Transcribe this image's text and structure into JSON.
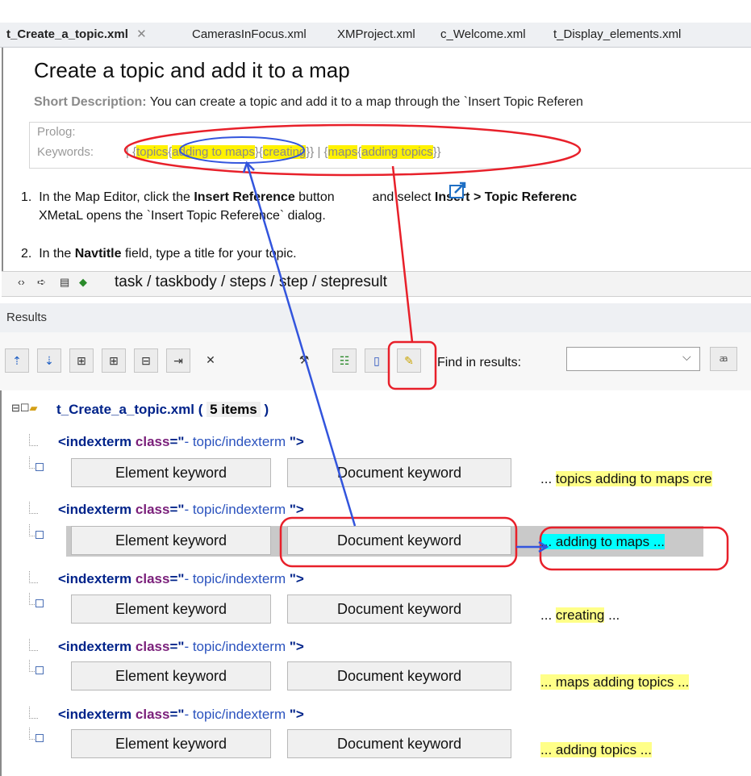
{
  "tabs": [
    {
      "label": "t_Create_a_topic.xml",
      "active": true,
      "close": "✕"
    },
    {
      "label": "CamerasInFocus.xml"
    },
    {
      "label": "XMProject.xml"
    },
    {
      "label": "c_Welcome.xml"
    },
    {
      "label": "t_Display_elements.xml"
    }
  ],
  "editor": {
    "title": "Create a topic and add it to a map",
    "short_desc_label": "Short Description:",
    "short_desc_text": "You can create a topic and add it to a map through the `Insert Topic Referen",
    "prolog_label": "Prolog:",
    "keywords_label": "Keywords:",
    "keywords": {
      "sep1": "| {",
      "topics": "topics",
      "open": "{",
      "adding_to_maps": "adding to maps",
      "close1": "}{",
      "creating": "creating",
      "close2": "}} | {",
      "maps": "maps",
      "open2": "{",
      "adding_topics": "adding topics",
      "close3": "}}"
    },
    "steps": [
      {
        "num": "1.",
        "pre": "In the Map Editor, click the ",
        "bold1": "Insert Reference",
        "mid": " button ",
        "post": " and select ",
        "bold2": "Insert > Topic Referenc",
        "line2": "XMetaL opens the `Insert Topic Reference` dialog."
      },
      {
        "num": "2.",
        "pre": "In the ",
        "bold1": "Navtitle",
        "post": " field, type a title for your topic."
      }
    ],
    "breadcrumb": "task / taskbody / steps / step / stepresult"
  },
  "results": {
    "title": "Results",
    "find_label": "Find in results:",
    "find_value": "",
    "file_node": {
      "name": "t_Create_a_topic.xml (",
      "count": "5 items",
      "close": ")"
    },
    "rows": [
      {
        "tag_open": "<indexterm ",
        "attr": "class",
        "eq": "=\"",
        "val": "- topic/indexterm ",
        "tag_close": "\">",
        "element_btn": "Element keyword",
        "document_btn": "Document keyword",
        "pre": "... ",
        "highlight": "topics adding to maps cre",
        "post": ""
      },
      {
        "tag_open": "<indexterm ",
        "attr": "class",
        "eq": "=\"",
        "val": "- topic/indexterm ",
        "tag_close": "\">",
        "element_btn": "Element keyword",
        "document_btn": "Document keyword",
        "pre": "",
        "highlight": "... adding to maps ...",
        "post": ""
      },
      {
        "tag_open": "<indexterm ",
        "attr": "class",
        "eq": "=\"",
        "val": "- topic/indexterm ",
        "tag_close": "\">",
        "element_btn": "Element keyword",
        "document_btn": "Document keyword",
        "pre": "... ",
        "highlight": "creating",
        "post": " ..."
      },
      {
        "tag_open": "<indexterm ",
        "attr": "class",
        "eq": "=\"",
        "val": "- topic/indexterm ",
        "tag_close": "\">",
        "element_btn": "Element keyword",
        "document_btn": "Document keyword",
        "pre": "",
        "highlight": "... maps adding topics ...",
        "post": ""
      },
      {
        "tag_open": "<indexterm ",
        "attr": "class",
        "eq": "=\"",
        "val": "- topic/indexterm ",
        "tag_close": "\">",
        "element_btn": "Element keyword",
        "document_btn": "Document keyword",
        "pre": "",
        "highlight": "... adding topics ...",
        "post": ""
      }
    ]
  },
  "colors": {
    "annotation_red": "#e8202a",
    "annotation_blue": "#3355dd",
    "highlight_yellow": "#fff200",
    "highlight_cyan": "#00ffff"
  }
}
